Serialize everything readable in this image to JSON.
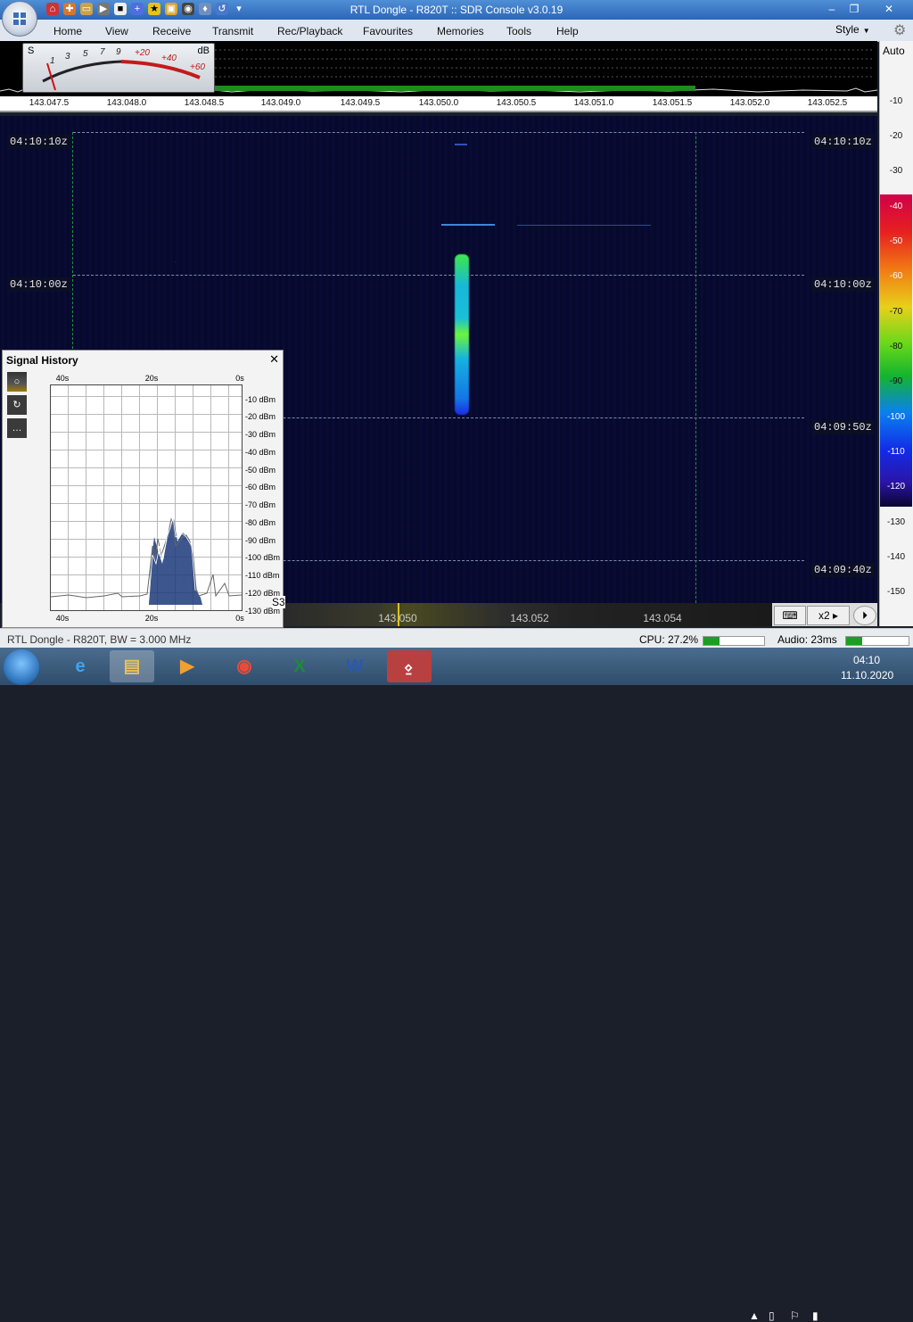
{
  "app": {
    "title": "RTL Dongle - R820T :: SDR Console v3.0.19",
    "window_controls": [
      "minimize-icon",
      "restore-icon",
      "close-icon"
    ]
  },
  "ribbon": {
    "tabs": [
      "Home",
      "View",
      "Receive",
      "Transmit",
      "Rec/Playback",
      "Favourites",
      "Memories",
      "Tools",
      "Help"
    ],
    "style_label": "Style"
  },
  "smeter": {
    "s_label": "S",
    "db_label": "dB",
    "s_scale": [
      "1",
      "3",
      "5",
      "7",
      "9"
    ],
    "db_scale": [
      "+20",
      "+40",
      "+60"
    ]
  },
  "freq_axis": [
    "143.047.5",
    "143.048.0",
    "143.048.5",
    "143.049.0",
    "143.049.5",
    "143.050.0",
    "143.050.5",
    "143.051.0",
    "143.051.5",
    "143.052.0",
    "143.052.5"
  ],
  "waterfall": {
    "time_labels": [
      "04:10:10z",
      "04:10:00z",
      "04:09:50z",
      "04:09:40z"
    ]
  },
  "db_scale": {
    "auto_label": "Auto",
    "labels": [
      "-10",
      "-20",
      "-30",
      "-40",
      "-50",
      "-60",
      "-70",
      "-80",
      "-90",
      "-100",
      "-110",
      "-120",
      "-130",
      "-140",
      "-150"
    ]
  },
  "bottom_bar": {
    "freqs": [
      "143.050",
      "143.052",
      "143.054"
    ],
    "zoom": "x2"
  },
  "signal_history": {
    "title": "Signal History",
    "x_labels": [
      "40s",
      "20s",
      "0s"
    ],
    "y_labels": [
      "-10 dBm",
      "-20 dBm",
      "-30 dBm",
      "-40 dBm",
      "-50 dBm",
      "-60 dBm",
      "-70 dBm",
      "-80 dBm",
      "-90 dBm",
      "-100 dBm",
      "-110 dBm",
      "-120 dBm",
      "-130 dBm"
    ],
    "s_reading": "S3"
  },
  "status": {
    "left": "RTL Dongle - R820T, BW = 3.000 MHz",
    "cpu_label": "CPU: 27.2%",
    "cpu_value": 0.272,
    "audio_label": "Audio: 23ms",
    "audio_value": 0.25
  },
  "taskbar": {
    "time": "04:10",
    "date": "11.10.2020",
    "apps": [
      "internet-explorer-icon",
      "file-explorer-icon",
      "media-player-icon",
      "chrome-icon",
      "excel-icon",
      "word-icon",
      "sdr-console-icon"
    ]
  },
  "colors": {
    "title_bar": "#2d66b8",
    "waterfall_bg": "#070a31",
    "signal": "#17b7d9",
    "grid_green": "#1e8f3a"
  }
}
